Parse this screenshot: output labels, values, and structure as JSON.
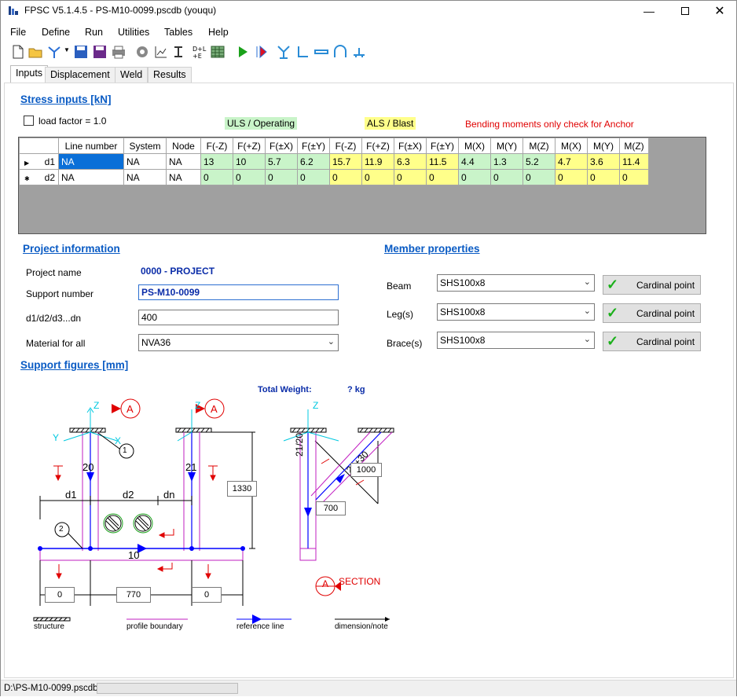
{
  "window": {
    "title": "FPSC V5.1.4.5 - PS-M10-0099.pscdb (youqu)"
  },
  "menu": [
    "File",
    "Define",
    "Run",
    "Utilities",
    "Tables",
    "Help"
  ],
  "tabs": [
    "Inputs",
    "Displacement",
    "Weld",
    "Results"
  ],
  "stress": {
    "section_title": "Stress inputs [kN]",
    "load_factor_label": "load factor = 1.0",
    "uls_label": "ULS / Operating",
    "als_label": "ALS / Blast",
    "bending_note": "Bending moments only check for Anchor",
    "columns": [
      "Line number",
      "System",
      "Node",
      "F(-Z)",
      "F(+Z)",
      "F(±X)",
      "F(±Y)",
      "F(-Z)",
      "F(+Z)",
      "F(±X)",
      "F(±Y)",
      "M(X)",
      "M(Y)",
      "M(Z)",
      "M(X)",
      "M(Y)",
      "M(Z)"
    ],
    "rows": [
      {
        "marker": "▶",
        "name": "d1",
        "cells": [
          "NA",
          "NA",
          "NA",
          "13",
          "10",
          "5.7",
          "6.2",
          "15.7",
          "11.9",
          "6.3",
          "11.5",
          "4.4",
          "1.3",
          "5.2",
          "4.7",
          "3.6",
          "11.4"
        ]
      },
      {
        "marker": "✱",
        "name": "d2",
        "cells": [
          "NA",
          "NA",
          "NA",
          "0",
          "0",
          "0",
          "0",
          "0",
          "0",
          "0",
          "0",
          "0",
          "0",
          "0",
          "0",
          "0",
          "0"
        ]
      }
    ]
  },
  "project": {
    "section_title": "Project information",
    "name_label": "Project name",
    "name_value": "0000 - PROJECT",
    "support_label": "Support number",
    "support_value": "PS-M10-0099",
    "d_label": "d1/d2/d3...dn",
    "d_value": "400",
    "material_label": "Material for all",
    "material_value": "NVA36"
  },
  "member": {
    "section_title": "Member properties",
    "items": [
      {
        "label": "Beam",
        "value": "SHS100x8",
        "button": "Cardinal point"
      },
      {
        "label": "Leg(s)",
        "value": "SHS100x8",
        "button": "Cardinal point"
      },
      {
        "label": "Brace(s)",
        "value": "SHS100x8",
        "button": "Cardinal point"
      }
    ]
  },
  "figures": {
    "section_title": "Support figures [mm]",
    "total_weight_label": "Total Weight:",
    "total_weight_value": "? kg",
    "labels": {
      "z": "Z",
      "x": "X",
      "y": "Y",
      "a": "A",
      "d1": "d1",
      "d2": "d2",
      "dn": "dn",
      "m20": "20",
      "m21": "21",
      "m10": "10",
      "m2120": "21/20",
      "m2130": "21+30",
      "c1": "1",
      "c2": "2",
      "h1330": "1330",
      "b0left": "0",
      "b770": "770",
      "b0right": "0",
      "b1000": "1000",
      "b700": "700",
      "section": "SECTION"
    },
    "legend": [
      "structure",
      "profile boundary",
      "reference line",
      "dimension/note"
    ]
  },
  "status": {
    "path": "D:\\PS-M10-0099.pscdb"
  }
}
